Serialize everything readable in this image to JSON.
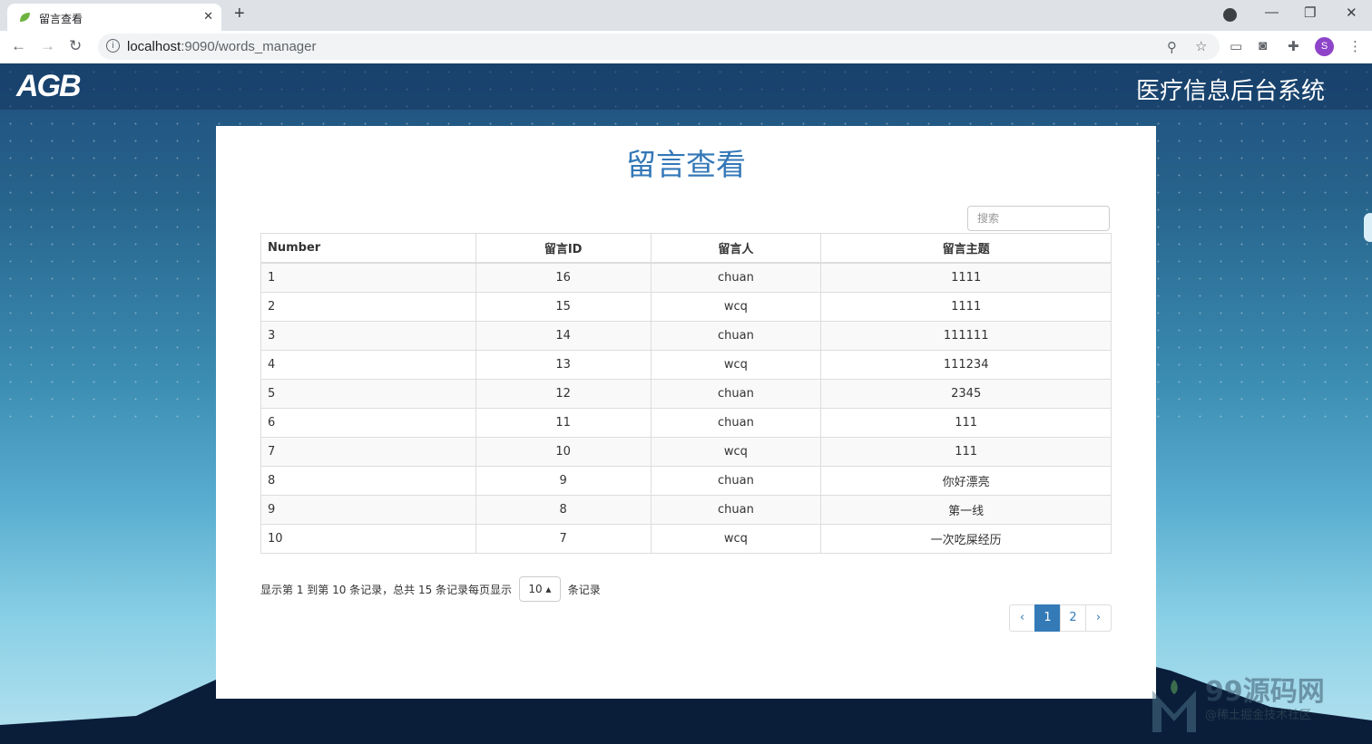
{
  "browser": {
    "tab_title": "留言查看",
    "tab_close": "✕",
    "new_tab": "+",
    "url_host": "localhost",
    "url_rest": ":9090/words_manager",
    "avatar_letter": "S"
  },
  "header": {
    "logo": "AGB",
    "system_title": "医疗信息后台系统"
  },
  "main": {
    "page_title": "留言查看",
    "search_placeholder": "搜索",
    "table": {
      "headers": [
        "Number",
        "留言ID",
        "留言人",
        "留言主题"
      ],
      "rows": [
        [
          "1",
          "16",
          "chuan",
          "1111"
        ],
        [
          "2",
          "15",
          "wcq",
          "1111"
        ],
        [
          "3",
          "14",
          "chuan",
          "111111"
        ],
        [
          "4",
          "13",
          "wcq",
          "111234"
        ],
        [
          "5",
          "12",
          "chuan",
          "2345"
        ],
        [
          "6",
          "11",
          "chuan",
          "111"
        ],
        [
          "7",
          "10",
          "wcq",
          "111"
        ],
        [
          "8",
          "9",
          "chuan",
          "你好漂亮"
        ],
        [
          "9",
          "8",
          "chuan",
          "第一线"
        ],
        [
          "10",
          "7",
          "wcq",
          "一次吃屎经历"
        ]
      ]
    },
    "pager": {
      "info_text": "显示第 1 到第 10 条记录，总共 15 条记录每页显示",
      "page_size": "10 ▴",
      "suffix": "条记录",
      "prev": "‹",
      "pages": [
        "1",
        "2"
      ],
      "next": "›"
    }
  },
  "watermark": {
    "brand": "99源码网",
    "sub": "@稀土掘金技术社区"
  }
}
